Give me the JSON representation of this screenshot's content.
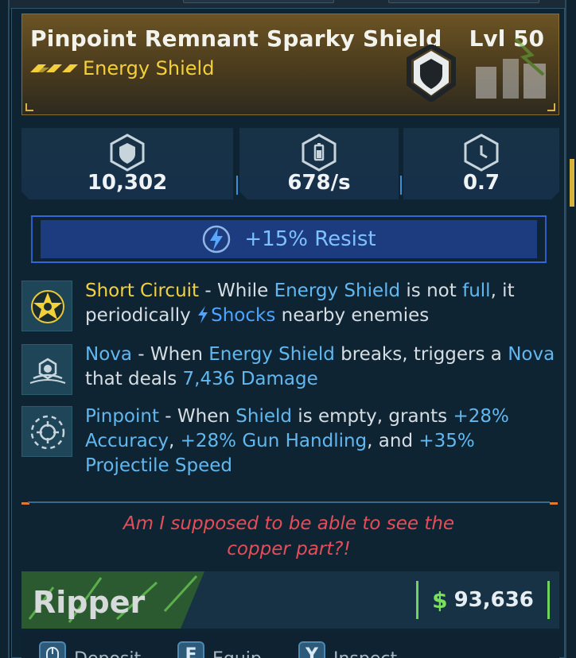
{
  "item": {
    "name": "Pinpoint Remnant Sparky Shield",
    "level": "Lvl 50",
    "type": "Energy Shield"
  },
  "stats": [
    {
      "icon": "shield-capacity-icon",
      "value": "10,302"
    },
    {
      "icon": "recharge-rate-icon",
      "value": "678/s"
    },
    {
      "icon": "recharge-delay-icon",
      "value": "0.7"
    }
  ],
  "resist": {
    "icon": "shock-element-icon",
    "text": "+15% Resist"
  },
  "perks": [
    {
      "icon": "short-circuit-perk-icon",
      "name": "Short Circuit",
      "t1": " - While ",
      "k1": "Energy Shield",
      "t2": " is not ",
      "k2": "full",
      "t3": ", it periodically ",
      "k3": "Shocks",
      "t4": " nearby enemies"
    },
    {
      "icon": "nova-perk-icon",
      "name": "Nova",
      "t1": " - When ",
      "k1": "Energy Shield",
      "t2": " breaks, triggers a ",
      "k2": "Nova",
      "t3": " that deals ",
      "k3": "7,436 Damage"
    },
    {
      "icon": "pinpoint-perk-icon",
      "name": "Pinpoint",
      "t1": " - When ",
      "k1": "Shield",
      "t2": " is empty, grants ",
      "k2": "+28% Accuracy",
      "t3": ", ",
      "k3": "+28% Gun Handling",
      "t4": ", and ",
      "k4": "+35% Projectile Speed"
    }
  ],
  "note": {
    "line1": "Am I supposed to be able to see the",
    "line2": "copper part?!"
  },
  "footer": {
    "manufacturer": "Ripper",
    "price_icon": "$",
    "price": "93,636"
  },
  "actions": [
    {
      "key": "",
      "label": "Deposit"
    },
    {
      "key": "E",
      "label": "Equip"
    },
    {
      "key": "Y",
      "label": "Inspect"
    }
  ],
  "colors": {
    "rarity": "#f2cf3b",
    "shock": "#4ea4ff",
    "note": "#e54d58",
    "price": "#78e05c"
  }
}
